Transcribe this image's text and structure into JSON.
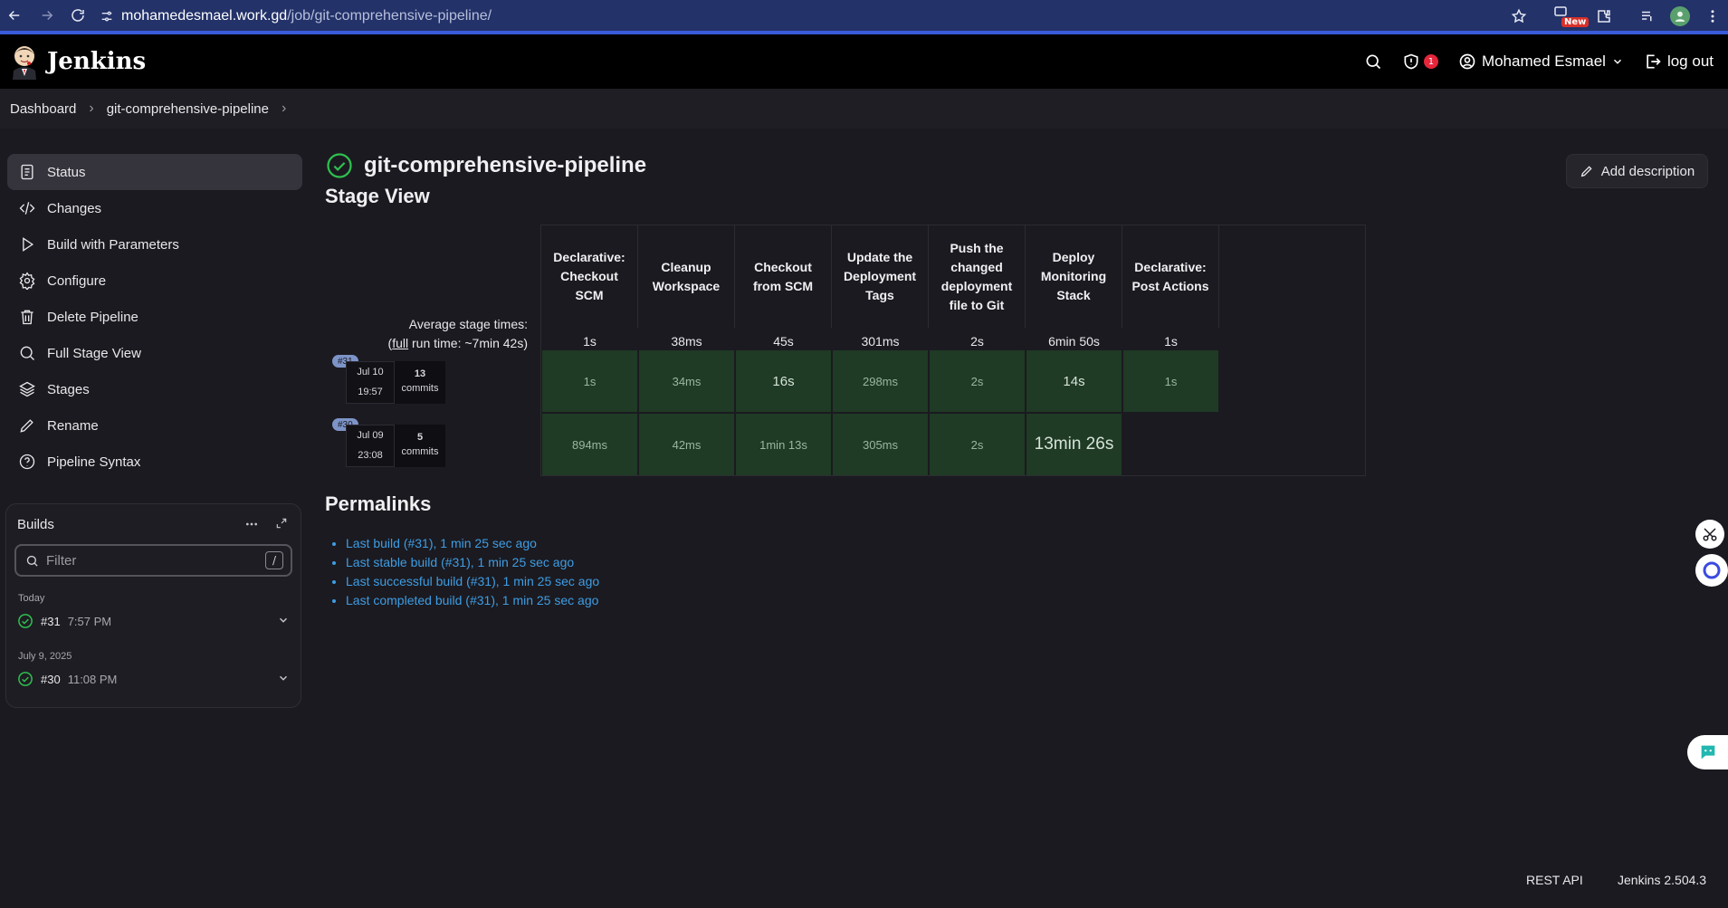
{
  "browser": {
    "url_host": "mohamedesmael.work.gd",
    "url_path": "/job/git-comprehensive-pipeline/",
    "new_badge": "New"
  },
  "header": {
    "app_name": "Jenkins",
    "security_count": "1",
    "user_name": "Mohamed Esmael",
    "logout_label": "log out"
  },
  "breadcrumb": {
    "items": [
      "Dashboard",
      "git-comprehensive-pipeline"
    ]
  },
  "sidebar": {
    "items": [
      {
        "label": "Status",
        "icon": "document-icon"
      },
      {
        "label": "Changes",
        "icon": "code-icon"
      },
      {
        "label": "Build with Parameters",
        "icon": "play-icon"
      },
      {
        "label": "Configure",
        "icon": "gear-icon"
      },
      {
        "label": "Delete Pipeline",
        "icon": "trash-icon"
      },
      {
        "label": "Full Stage View",
        "icon": "search-icon"
      },
      {
        "label": "Stages",
        "icon": "layers-icon"
      },
      {
        "label": "Rename",
        "icon": "pencil-icon"
      },
      {
        "label": "Pipeline Syntax",
        "icon": "help-icon"
      }
    ]
  },
  "builds": {
    "title": "Builds",
    "filter_placeholder": "Filter",
    "filter_key": "/",
    "groups": [
      {
        "label": "Today",
        "build": {
          "number": "#31",
          "time": "7:57 PM"
        }
      },
      {
        "label": "July 9, 2025",
        "build": {
          "number": "#30",
          "time": "11:08 PM"
        }
      }
    ]
  },
  "job": {
    "title": "git-comprehensive-pipeline",
    "add_description": "Add description",
    "status_color": "#2fbf4f"
  },
  "stage_view": {
    "heading": "Stage View",
    "avg_label_line1": "Average stage times:",
    "avg_label_full": "full",
    "avg_label_rest": " run time: ~7min 42s)",
    "avg_label_open": "(",
    "stages": [
      {
        "name": "Declarative: Checkout SCM",
        "avg": "1s",
        "avg_fraction": 0.0
      },
      {
        "name": "Cleanup Workspace",
        "avg": "38ms",
        "avg_fraction": 0.0
      },
      {
        "name": "Checkout from SCM",
        "avg": "45s",
        "avg_fraction": 0.08
      },
      {
        "name": "Update the Deployment Tags",
        "avg": "301ms",
        "avg_fraction": 0.0
      },
      {
        "name": "Push the changed deployment file to Git",
        "avg": "2s",
        "avg_fraction": 0.0
      },
      {
        "name": "Deploy Monitoring Stack",
        "avg": "6min 50s",
        "avg_fraction": 0.78
      },
      {
        "name": "Declarative: Post Actions",
        "avg": "1s",
        "avg_fraction": 0.0
      }
    ],
    "runs": [
      {
        "badge": "#31",
        "date": "Jul 10",
        "time": "19:57",
        "commits_count": "13",
        "commits_label": "commits",
        "cells": [
          "1s",
          "34ms",
          "16s",
          "298ms",
          "2s",
          "14s",
          "1s"
        ]
      },
      {
        "badge": "#30",
        "date": "Jul 09",
        "time": "23:08",
        "commits_count": "5",
        "commits_label": "commits",
        "cells": [
          "894ms",
          "42ms",
          "1min 13s",
          "305ms",
          "2s",
          "13min 26s",
          ""
        ]
      }
    ],
    "success_color": "#1f3a25"
  },
  "permalinks": {
    "heading": "Permalinks",
    "items": [
      "Last build (#31), 1 min 25 sec ago",
      "Last stable build (#31), 1 min 25 sec ago",
      "Last successful build (#31), 1 min 25 sec ago",
      "Last completed build (#31), 1 min 25 sec ago"
    ]
  },
  "footer": {
    "rest_api": "REST API",
    "version": "Jenkins 2.504.3"
  }
}
